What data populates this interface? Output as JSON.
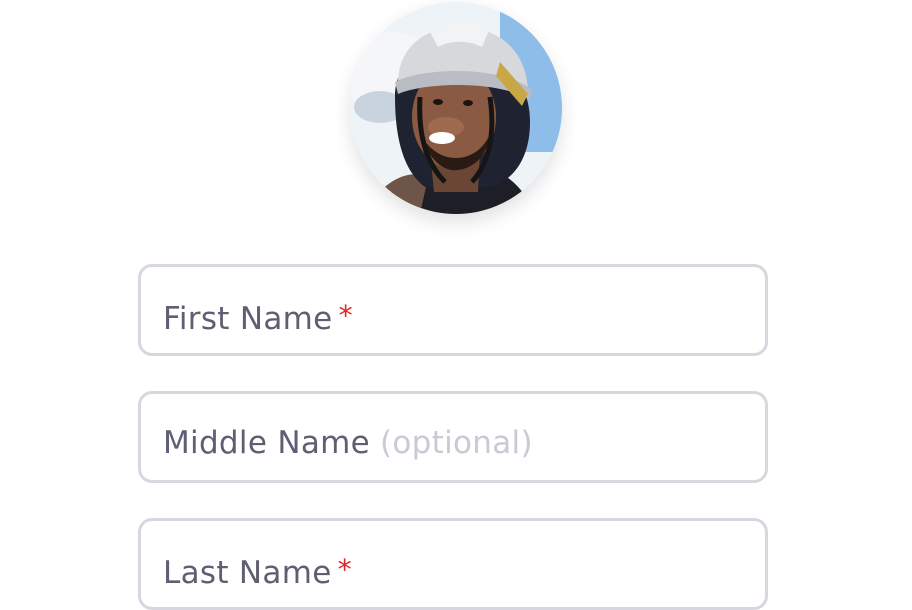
{
  "profile": {
    "avatar_icon": "user-photo-construction-worker"
  },
  "form": {
    "first_name": {
      "label": "First Name",
      "required_mark": "*"
    },
    "middle_name": {
      "label": "Middle Name",
      "optional_hint": "(optional)"
    },
    "last_name": {
      "label": "Last Name",
      "required_mark": "*"
    }
  },
  "colors": {
    "border": "#d7d7df",
    "label_text": "#5e5f73",
    "hint_text": "#c9cad4",
    "required": "#e02525"
  }
}
